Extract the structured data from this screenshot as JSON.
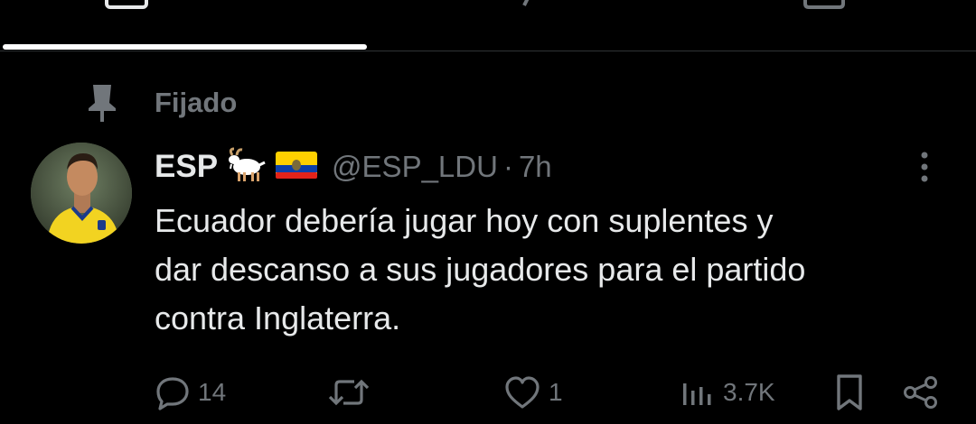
{
  "tabs": {
    "active_icon": "posts-icon",
    "icons": [
      "posts-icon",
      "replies-icon",
      "media-icon"
    ]
  },
  "pinned": {
    "label": "Fijado",
    "icon": "pin-icon"
  },
  "tweet": {
    "author_name": "ESP",
    "author_emojis": "goat-emoji, ecuador-flag-emoji",
    "handle": "@ESP_LDU",
    "separator": "·",
    "time": "7h",
    "text": "Ecuador debería jugar hoy con suplentes y\ndar descanso a sus jugadores para el partido\ncontra Inglaterra.",
    "avatar": "profile-photo-yellow-ecuador-jersey"
  },
  "actions": {
    "reply_count": "14",
    "repost_count": "",
    "like_count": "1",
    "views_count": "3.7K"
  },
  "colors": {
    "background": "#000000",
    "primary_text": "#e7e9ea",
    "secondary_text": "#71767b",
    "divider": "#2f3336",
    "indicator": "#ffffff"
  }
}
